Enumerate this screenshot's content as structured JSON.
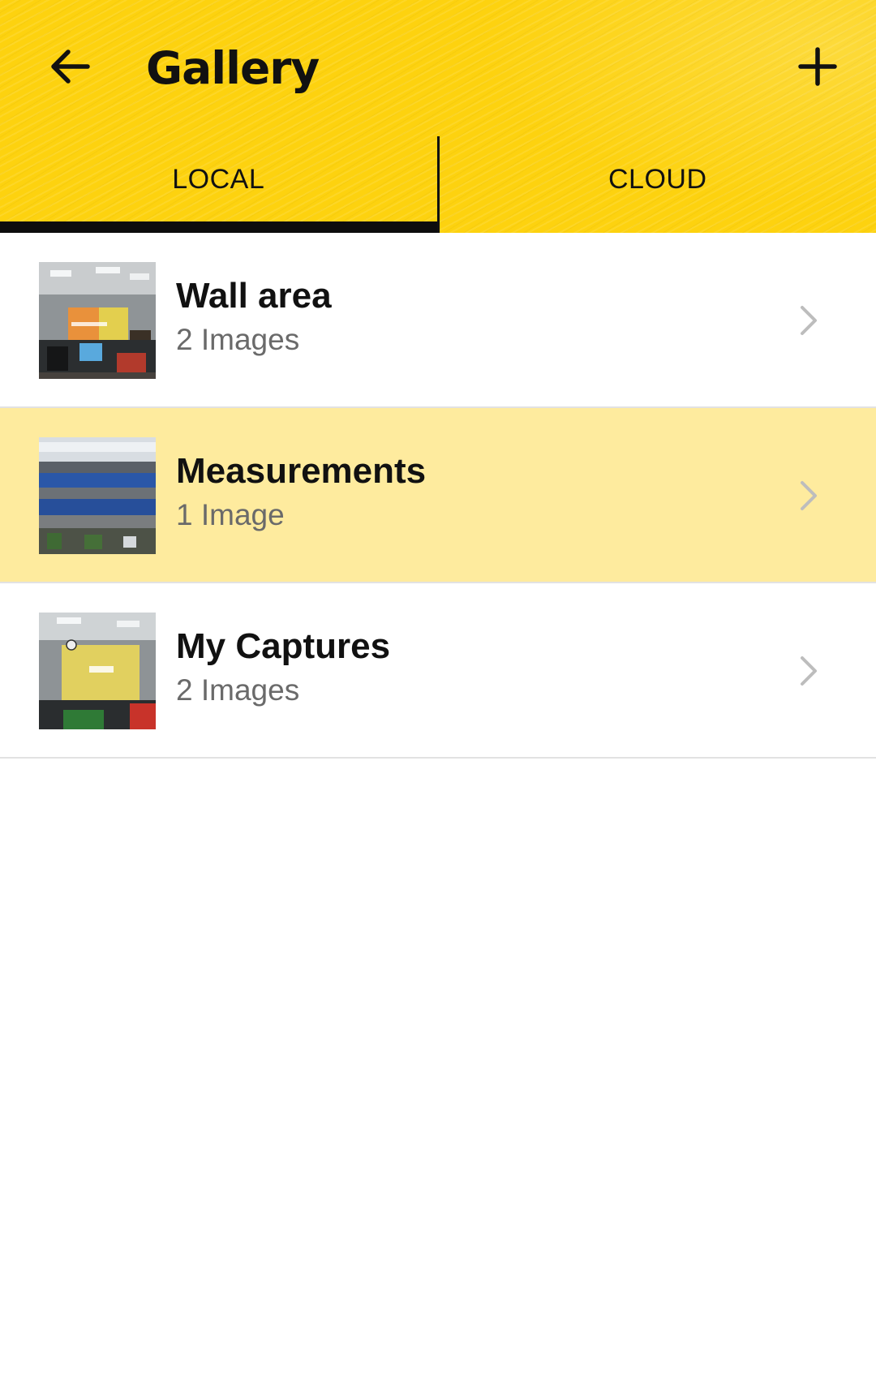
{
  "header": {
    "title": "Gallery",
    "back_icon": "arrow-left-icon",
    "add_icon": "plus-icon",
    "background_color": "#FDD20F"
  },
  "tabs": [
    {
      "label": "LOCAL",
      "active": true
    },
    {
      "label": "CLOUD",
      "active": false
    }
  ],
  "albums": [
    {
      "title": "Wall area",
      "subtitle": "2 Images",
      "selected": false,
      "chevron_icon": "chevron-right-icon"
    },
    {
      "title": "Measurements",
      "subtitle": "1 Image",
      "selected": true,
      "chevron_icon": "chevron-right-icon"
    },
    {
      "title": "My Captures",
      "subtitle": "2 Images",
      "selected": false,
      "chevron_icon": "chevron-right-icon"
    }
  ],
  "colors": {
    "accent": "#FDD20F",
    "selected_row": "#FEEB9E",
    "text_primary": "#111111",
    "text_secondary": "#6a6a6a"
  }
}
